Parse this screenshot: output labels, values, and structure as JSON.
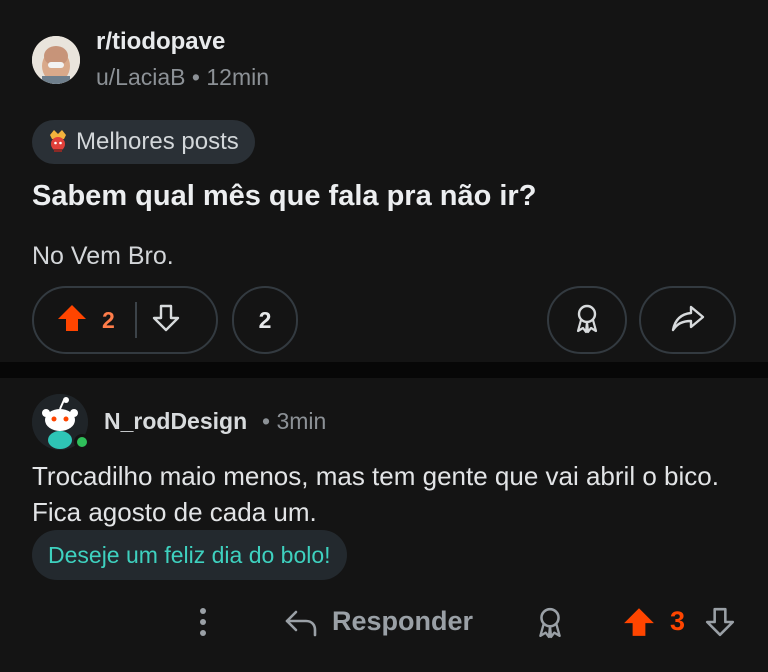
{
  "post": {
    "subreddit": "r/tiodopave",
    "author": "u/LaciaB",
    "separator": "•",
    "age": "12min",
    "flair": "Melhores posts",
    "title": "Sabem qual mês que fala pra não ir?",
    "body": "No Vem Bro.",
    "vote_count": "2",
    "comment_count": "2"
  },
  "comment": {
    "author": "N_rodDesign",
    "age": "• 3min",
    "text": "Trocadilho maio menos, mas tem gente que vai abril o bico. Fica agosto de cada um.",
    "cake_label": "Deseje um feliz dia do bolo!",
    "reply_label": "Responder",
    "score": "3"
  },
  "colors": {
    "upvote_active": "#ff4500",
    "vote_count": "#ff7d4a",
    "cake_text": "#3ed1bf",
    "online": "#2fbf5a"
  },
  "icons": [
    "crown-flair-icon",
    "upvote-icon",
    "downvote-icon",
    "award-icon",
    "share-icon",
    "more-icon",
    "reply-icon"
  ]
}
